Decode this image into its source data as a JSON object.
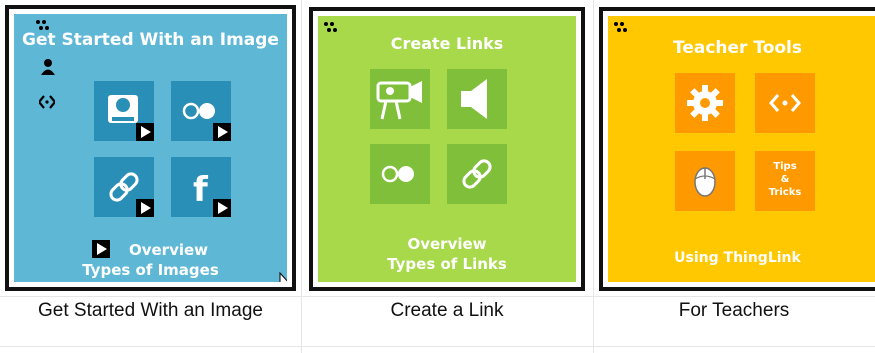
{
  "cards": [
    {
      "title": "Get Started With an Image",
      "bottom_line1": "Overview",
      "bottom_line2": "Types of Images",
      "caption": "Get Started With an Image",
      "color": "#5fb7d6",
      "tiles": [
        "hard-drive-icon",
        "flickr-icon",
        "link-icon",
        "facebook-icon"
      ]
    },
    {
      "title": "Create Links",
      "bottom_line1": "Overview",
      "bottom_line2": "Types of Links",
      "caption": "Create a Link",
      "color": "#a7d94a",
      "tiles": [
        "video-camera-icon",
        "speaker-icon",
        "flickr-icon",
        "link-icon"
      ]
    },
    {
      "title": "Teacher Tools",
      "bottom_line1": "Using ThingLink",
      "caption": "For Teachers",
      "color": "#ffc800",
      "tiles": [
        "gear-icon",
        "embed-code-icon",
        "mouse-icon",
        "tips-and-tricks-icon"
      ],
      "tips_tile": [
        "Tips",
        "&",
        "Tricks"
      ]
    }
  ]
}
